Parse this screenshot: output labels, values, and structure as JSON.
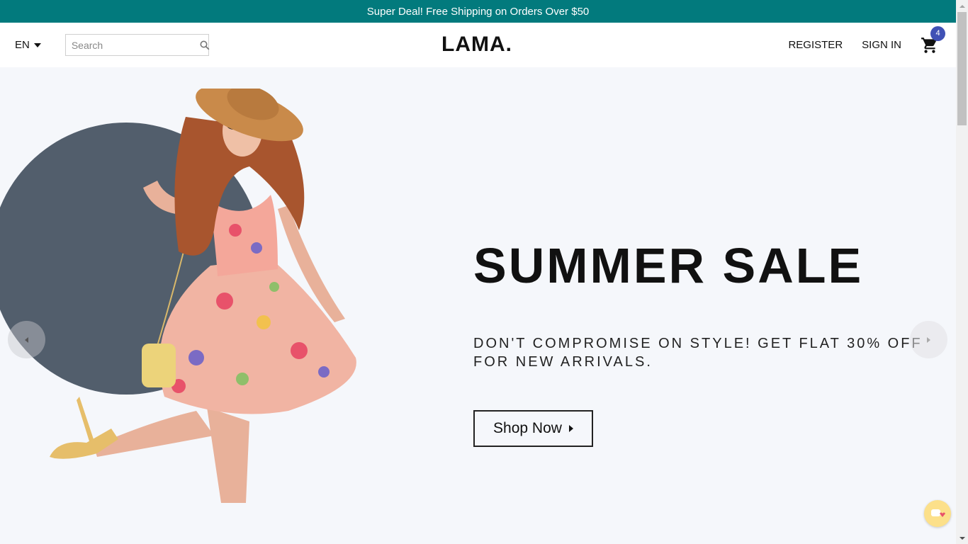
{
  "announcement": {
    "text": "Super Deal! Free Shipping on Orders Over $50"
  },
  "navbar": {
    "language": "EN",
    "search": {
      "placeholder": "Search",
      "value": ""
    },
    "logo": "LAMA.",
    "register_label": "REGISTER",
    "signin_label": "SIGN IN",
    "cart_count": "4"
  },
  "slider": {
    "title": "SUMMER SALE",
    "description": "DON'T COMPROMISE ON STYLE! GET FLAT 30% OFF FOR NEW ARRIVALS.",
    "button_label": "Shop Now"
  },
  "icons": {
    "search": "search-icon",
    "cart": "shopping-cart-icon",
    "lang_caret": "caret-down-icon",
    "arrow_left": "arrow-left-icon",
    "arrow_right": "arrow-right-icon",
    "chat": "chat-widget-icon"
  },
  "colors": {
    "announcement_bg": "#027a7d",
    "badge_bg": "#4051b5",
    "hero_bg": "#f5f7fb",
    "circle": "#525e6c"
  }
}
